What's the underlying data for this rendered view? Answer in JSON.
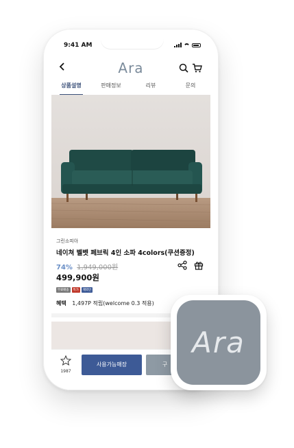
{
  "status": {
    "time": "9:41 AM"
  },
  "app": {
    "logo": "Ara"
  },
  "tabs": [
    {
      "label": "상품설명",
      "active": true
    },
    {
      "label": "판매정보",
      "active": false
    },
    {
      "label": "리뷰",
      "active": false
    },
    {
      "label": "문의",
      "active": false
    }
  ],
  "product": {
    "brand": "그린소피아",
    "name": "네이쳐 벨벳 페브릭 4인 소파 4colors(쿠션증정)",
    "discount": "74%",
    "original_price": "1,949,000원",
    "price": "499,900원",
    "badges": [
      {
        "label": "무료배송",
        "color": "#7a7a7a"
      },
      {
        "label": "특가",
        "color": "#c0392b"
      },
      {
        "label": "해외인",
        "color": "#3d5a96"
      }
    ],
    "benefit_label": "혜택",
    "benefit_text": "1,497P 적립(welcome 0.3 적용)"
  },
  "bottom": {
    "fav_count": "1987",
    "store_button": "사용가능매장",
    "buy_button": "구"
  },
  "appicon": {
    "label": "Ara"
  },
  "colors": {
    "accent": "#3d5a96",
    "logo": "#7b8b9b",
    "discount": "#6a8fc6",
    "icon_bg": "#8b949d"
  }
}
